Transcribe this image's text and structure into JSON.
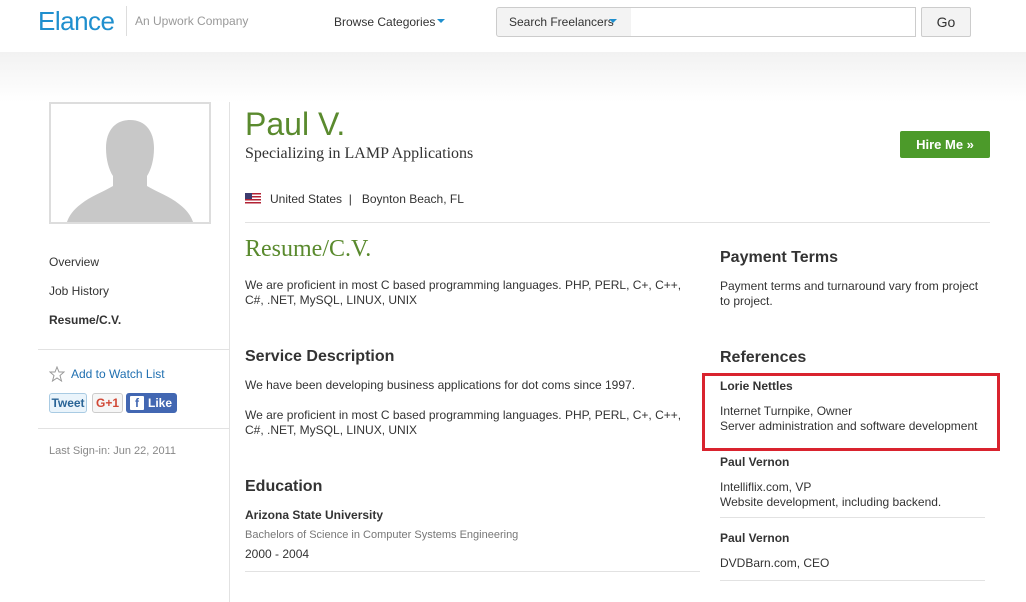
{
  "header": {
    "logo": "Elance",
    "tagline": "An Upwork Company",
    "browse_label": "Browse Categories",
    "search_dropdown_label": "Search Freelancers",
    "search_value": "",
    "go_label": "Go"
  },
  "sidebar": {
    "nav": [
      {
        "label": "Overview"
      },
      {
        "label": "Job History"
      },
      {
        "label": "Resume/C.V."
      }
    ],
    "watch_label": "Add to Watch List",
    "tweet_label": "Tweet",
    "gplus_label": "G+1",
    "like_label": "Like",
    "last_signin": "Last Sign-in: Jun 22, 2011"
  },
  "profile": {
    "name": "Paul V.",
    "specialty": "Specializing in LAMP Applications",
    "hire_label": "Hire Me »",
    "location": "United States  |   Boynton Beach, FL"
  },
  "resume": {
    "title": "Resume/C.V.",
    "text": "We are proficient in most C based programming languages. PHP, PERL, C+, C++, C#, .NET, MySQL, LINUX, UNIX"
  },
  "service": {
    "title": "Service Description",
    "text1": "We have been developing business applications for dot coms since 1997.",
    "text2": "We are proficient in most C based programming languages. PHP, PERL, C+, C++, C#, .NET, MySQL, LINUX, UNIX"
  },
  "education": {
    "title": "Education",
    "school": "Arizona State University",
    "degree": "Bachelors of Science in Computer Systems Engineering",
    "years": "2000 - 2004"
  },
  "payment": {
    "title": "Payment Terms",
    "text": "Payment terms and turnaround vary from project to project."
  },
  "references": {
    "title": "References",
    "items": [
      {
        "name": "Lorie Nettles",
        "role": "Internet Turnpike, Owner",
        "desc": "Server administration and software development"
      },
      {
        "name": "Paul Vernon",
        "role": "Intelliflix.com, VP",
        "desc": "Website development, including backend."
      },
      {
        "name": "Paul Vernon",
        "role": "DVDBarn.com, CEO",
        "desc": ""
      }
    ]
  },
  "colors": {
    "brand_blue": "#1f8fce",
    "accent_green": "#5a8a2e",
    "hire_green": "#4c9a2a",
    "highlight_red": "#d9232e"
  }
}
